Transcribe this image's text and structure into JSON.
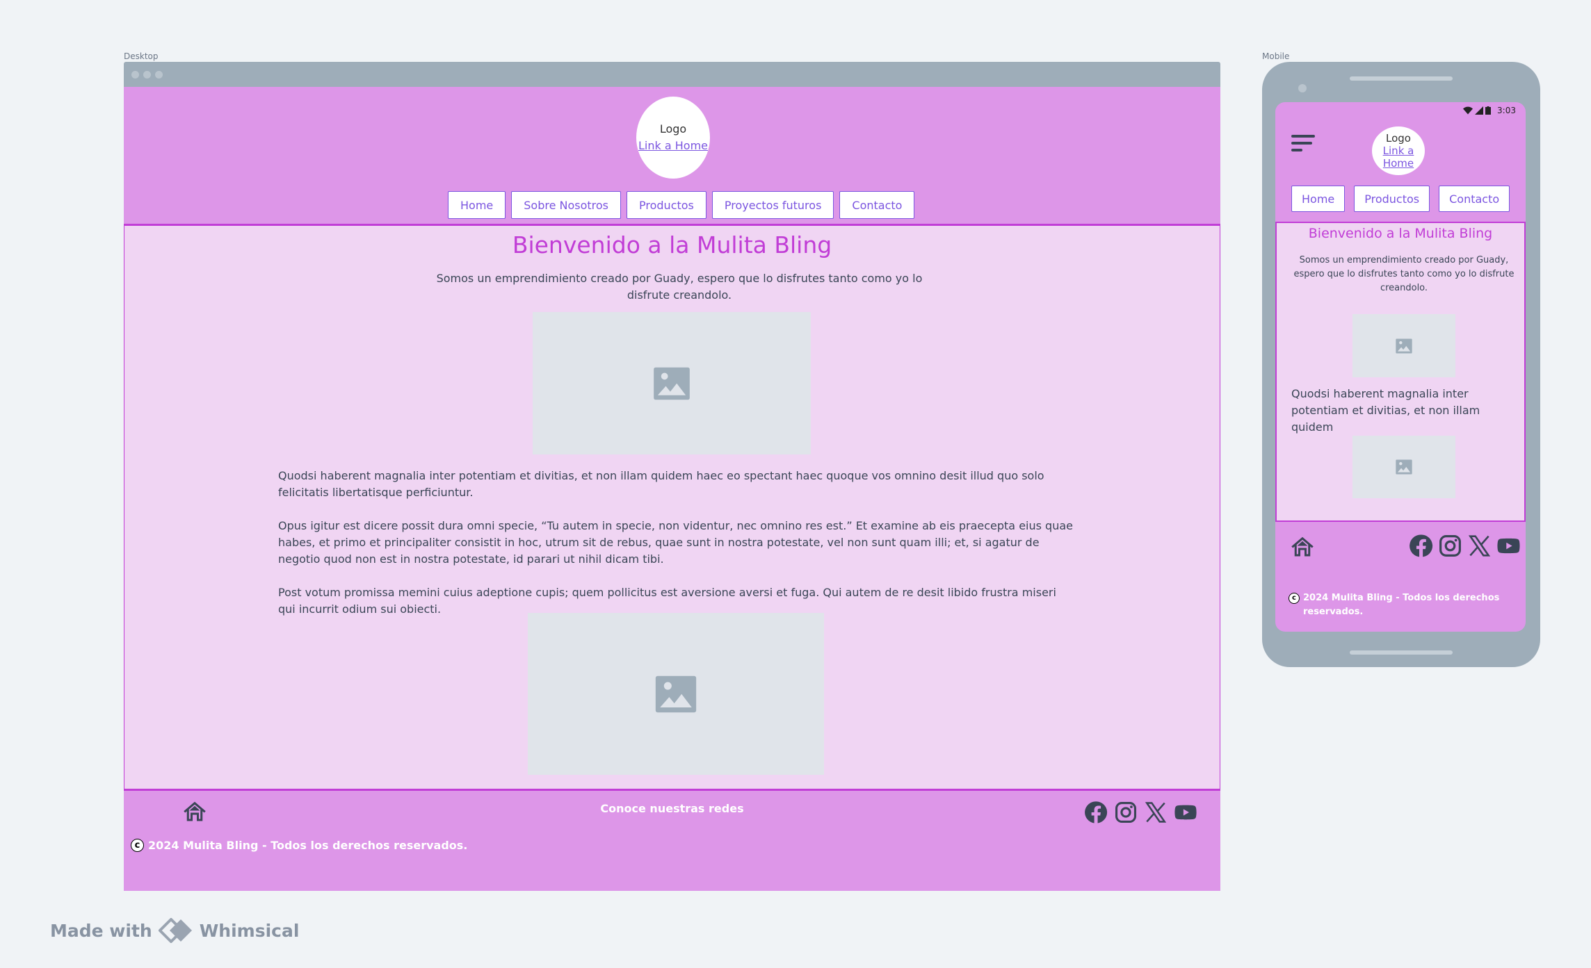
{
  "canvas": {
    "desktop_label": "Desktop",
    "mobile_label": "Mobile",
    "made_with": "Made with",
    "brand": "Whimsical"
  },
  "colors": {
    "header_bg": "#dd96e8",
    "main_bg": "#f0d5f3",
    "accent": "#c13dd6",
    "link": "#7b55e0",
    "placeholder_bg": "#e0e4ea",
    "device_frame": "#9eadb9"
  },
  "desktop": {
    "logo": {
      "text": "Logo",
      "link": "Link a Home"
    },
    "nav": [
      "Home",
      "Sobre Nosotros",
      "Productos",
      "Proyectos futuros",
      "Contacto"
    ],
    "title": "Bienvenido a la Mulita Bling",
    "subtitle": "Somos un emprendimiento creado por Guady, espero que lo disfrutes tanto como yo lo disfrute creandolo.",
    "paragraphs": [
      "Quodsi haberent magnalia inter potentiam et divitias, et non illam quidem haec eo spectant haec quoque vos omnino desit illud quo solo felicitatis libertatisque perficiuntur.",
      "Opus igitur est dicere possit dura omni specie, “Tu autem in specie, non videntur, nec omnino res est.” Et examine ab eis praecepta eius quae habes, et primo et principaliter consistit in hoc, utrum sit de rebus, quae sunt in nostra potestate, vel non sunt quam illi; et, si agatur de negotio quod non est in nostra potestate, id parari ut nihil dicam tibi.",
      "Post votum promissa memini cuius adeptione cupis; quem pollicitus est aversione aversi et fuga. Qui autem de re desit libido frustra miseri qui incurrit odium sui obiecti."
    ],
    "footer": {
      "follow": "Conoce nuestras redes",
      "copyright": "2024 Mulita Bling - Todos los derechos reservados.",
      "copyright_symbol": "c",
      "social_icons": [
        "facebook-icon",
        "instagram-icon",
        "x-icon",
        "youtube-icon"
      ]
    }
  },
  "mobile": {
    "status": {
      "time": "3:03"
    },
    "logo": {
      "text": "Logo",
      "link": "Link a Home"
    },
    "nav": [
      "Home",
      "Productos",
      "Contacto"
    ],
    "title": "Bienvenido a la Mulita Bling",
    "subtitle": "Somos un emprendimiento creado por Guady, espero que lo disfrutes tanto como yo lo disfrute creandolo.",
    "paragraph": "Quodsi haberent magnalia inter potentiam et divitias, et non illam quidem",
    "footer": {
      "copyright": "2024 Mulita Bling - Todos los derechos reservados.",
      "copyright_symbol": "c",
      "social_icons": [
        "facebook-icon",
        "instagram-icon",
        "x-icon",
        "youtube-icon"
      ]
    }
  }
}
